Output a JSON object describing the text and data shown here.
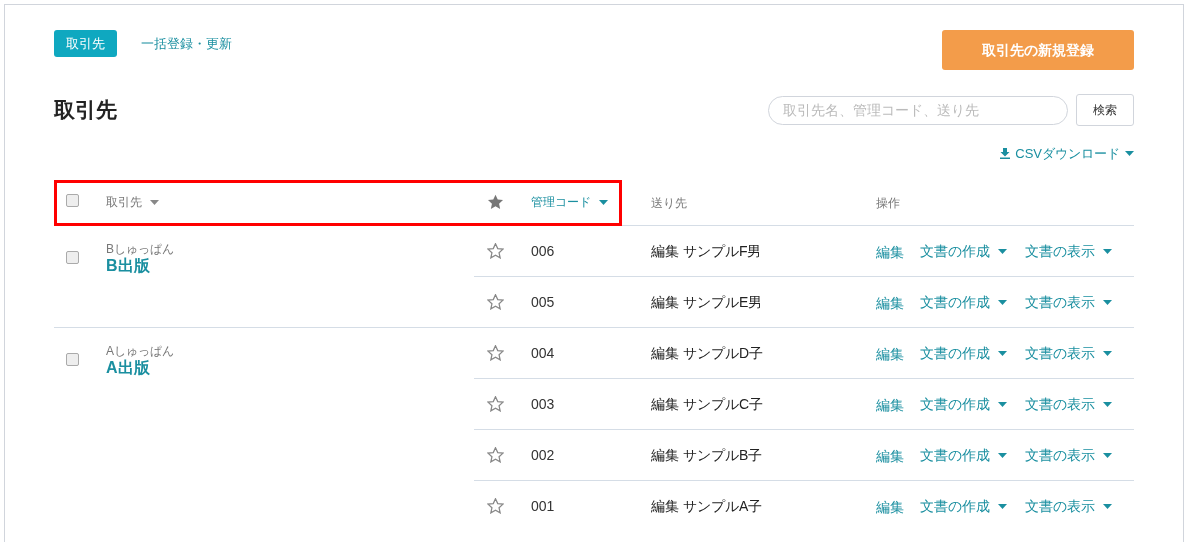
{
  "tabs": [
    {
      "label": "取引先",
      "selected": true
    },
    {
      "label": "一括登録・更新",
      "selected": false
    }
  ],
  "new_button": "取引先の新規登録",
  "title": "取引先",
  "search": {
    "placeholder": "取引先名、管理コード、送り先",
    "button": "検索"
  },
  "csv_download": "CSVダウンロード",
  "table": {
    "highlighted": true,
    "header_checkbox": {
      "checked": false
    },
    "columns": [
      {
        "label": "取引先",
        "sorted": false
      },
      {
        "label": "管理コード",
        "sorted": true
      },
      {
        "label": "送り先"
      },
      {
        "label": "操作"
      }
    ],
    "groups": [
      {
        "kana": "Bしゅっぱん",
        "name": "B出版",
        "checked": false,
        "rows": [
          {
            "starred": false,
            "code": "006",
            "recipient": "編集 サンプルF男",
            "actions": [
              {
                "label": "編集",
                "kind": "link"
              },
              {
                "label": "文書の作成",
                "kind": "dropdown"
              },
              {
                "label": "文書の表示",
                "kind": "dropdown"
              }
            ]
          },
          {
            "starred": false,
            "code": "005",
            "recipient": "編集 サンプルE男",
            "actions": [
              {
                "label": "編集",
                "kind": "link"
              },
              {
                "label": "文書の作成",
                "kind": "dropdown"
              },
              {
                "label": "文書の表示",
                "kind": "dropdown"
              }
            ]
          }
        ]
      },
      {
        "kana": "Aしゅっぱん",
        "name": "A出版",
        "checked": false,
        "rows": [
          {
            "starred": false,
            "code": "004",
            "recipient": "編集 サンプルD子",
            "actions": [
              {
                "label": "編集",
                "kind": "link"
              },
              {
                "label": "文書の作成",
                "kind": "dropdown"
              },
              {
                "label": "文書の表示",
                "kind": "dropdown"
              }
            ]
          },
          {
            "starred": false,
            "code": "003",
            "recipient": "編集 サンプルC子",
            "actions": [
              {
                "label": "編集",
                "kind": "link"
              },
              {
                "label": "文書の作成",
                "kind": "dropdown"
              },
              {
                "label": "文書の表示",
                "kind": "dropdown"
              }
            ]
          },
          {
            "starred": false,
            "code": "002",
            "recipient": "編集 サンプルB子",
            "actions": [
              {
                "label": "編集",
                "kind": "link"
              },
              {
                "label": "文書の作成",
                "kind": "dropdown"
              },
              {
                "label": "文書の表示",
                "kind": "dropdown"
              }
            ]
          },
          {
            "starred": false,
            "code": "001",
            "recipient": "編集 サンプルA子",
            "actions": [
              {
                "label": "編集",
                "kind": "link"
              },
              {
                "label": "文書の作成",
                "kind": "dropdown"
              },
              {
                "label": "文書の表示",
                "kind": "dropdown"
              }
            ]
          }
        ]
      }
    ]
  }
}
